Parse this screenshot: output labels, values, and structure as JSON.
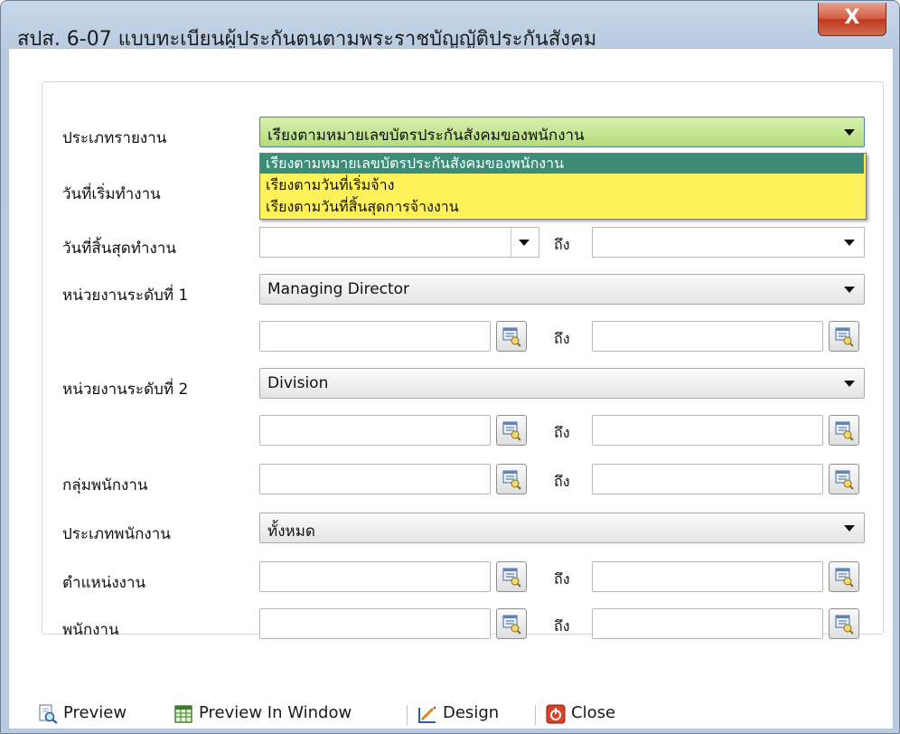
{
  "window": {
    "title": "สปส. 6-07 แบบทะเบียนผู้ประกันตนตามพระราชบัญญัติประกันสังคม",
    "close_glyph": "X"
  },
  "form": {
    "report_type": {
      "label": "ประเภทรายงาน",
      "value": "เรียงตามหมายเลขบัตรประกันสังคมของพนักงาน",
      "options": [
        "เรียงตามหมายเลขบัตรประกันสังคมของพนักงาน",
        "เรียงตามวันที่เริ่มจ้าง",
        "เรียงตามวันที่สิ้นสุดการจ้างงาน"
      ],
      "selected_index": 0
    },
    "start_date": {
      "label": "วันที่เริ่มทำงาน"
    },
    "end_date": {
      "label": "วันที่สิ้นสุดทำงาน",
      "to_label": "ถึง"
    },
    "unit_level1": {
      "label": "หน่วยงานระดับที่ 1",
      "value": "Managing Director",
      "to_label": "ถึง"
    },
    "unit_level2": {
      "label": "หน่วยงานระดับที่ 2",
      "value": "Division",
      "to_label": "ถึง"
    },
    "employee_group": {
      "label": "กลุ่มพนักงาน",
      "to_label": "ถึง"
    },
    "employee_type": {
      "label": "ประเภทพนักงาน",
      "value": "ทั้งหมด"
    },
    "position": {
      "label": "ตำแหน่งงาน",
      "to_label": "ถึง"
    },
    "employee": {
      "label": "พนักงาน",
      "to_label": "ถึง"
    }
  },
  "toolbar": {
    "preview": "Preview",
    "preview_window": "Preview In Window",
    "design": "Design",
    "close": "Close"
  },
  "icons": {
    "lookup": "search-list-icon",
    "preview": "magnifier-page-icon",
    "preview_window": "window-grid-icon",
    "design": "ruler-pencil-icon",
    "close": "power-icon"
  },
  "colors": {
    "dropdown_bg": "#fff15a",
    "selected_option": "#3d8c77",
    "active_combo": "#b4dc7a",
    "close_button": "#c0391f"
  }
}
